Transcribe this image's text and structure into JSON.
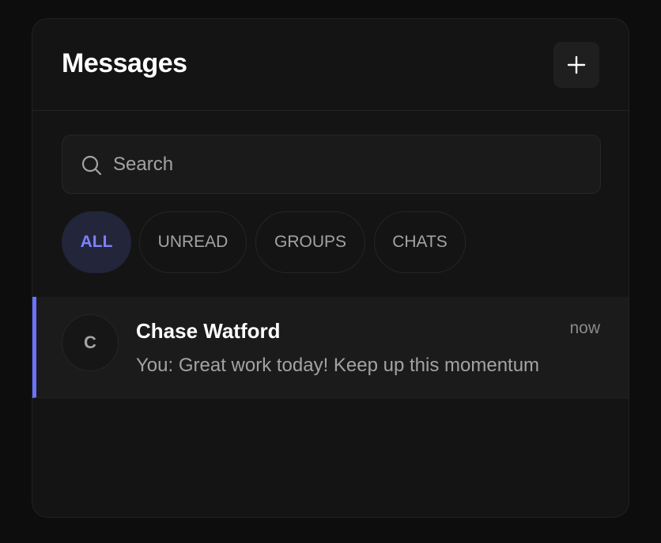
{
  "header": {
    "title": "Messages",
    "new_icon": "plus-icon"
  },
  "search": {
    "placeholder": "Search",
    "value": "",
    "icon": "search-icon"
  },
  "filters": [
    {
      "label": "ALL",
      "active": true
    },
    {
      "label": "UNREAD",
      "active": false
    },
    {
      "label": "GROUPS",
      "active": false
    },
    {
      "label": "CHATS",
      "active": false
    }
  ],
  "conversations": [
    {
      "initial": "C",
      "name": "Chase Watford",
      "time": "now",
      "preview": "You: Great work today! Keep up this momentum",
      "selected": true
    }
  ],
  "colors": {
    "accent": "#6c73ff",
    "background": "#0d0d0d",
    "panel": "#141414"
  }
}
